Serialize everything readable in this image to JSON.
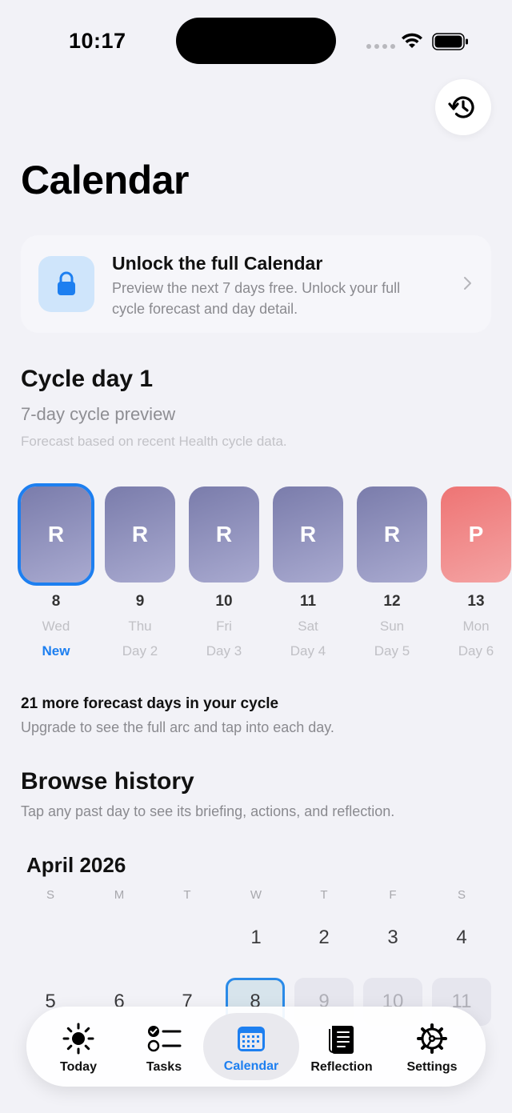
{
  "status": {
    "time": "10:17"
  },
  "header": {
    "title": "Calendar"
  },
  "unlock": {
    "title": "Unlock the full Calendar",
    "description": "Preview the next 7 days free. Unlock your full cycle forecast and day detail."
  },
  "cycle": {
    "title": "Cycle day 1",
    "preview": "7-day cycle preview",
    "note": "Forecast based on recent Health cycle data."
  },
  "days": [
    {
      "letter": "R",
      "num": "8",
      "weekday": "Wed",
      "sub": "New",
      "type": "r",
      "selected": true
    },
    {
      "letter": "R",
      "num": "9",
      "weekday": "Thu",
      "sub": "Day 2",
      "type": "r"
    },
    {
      "letter": "R",
      "num": "10",
      "weekday": "Fri",
      "sub": "Day 3",
      "type": "r"
    },
    {
      "letter": "R",
      "num": "11",
      "weekday": "Sat",
      "sub": "Day 4",
      "type": "r"
    },
    {
      "letter": "R",
      "num": "12",
      "weekday": "Sun",
      "sub": "Day 5",
      "type": "r"
    },
    {
      "letter": "P",
      "num": "13",
      "weekday": "Mon",
      "sub": "Day 6",
      "type": "p"
    }
  ],
  "forecast_more": {
    "title": "21 more forecast days in your cycle",
    "description": "Upgrade to see the full arc and tap into each day."
  },
  "browse": {
    "title": "Browse history",
    "description": "Tap any past day to see its briefing, actions, and reflection."
  },
  "calendar": {
    "month": "April 2026",
    "weekdays": [
      "S",
      "M",
      "T",
      "W",
      "T",
      "F",
      "S"
    ],
    "week1": [
      "1",
      "2",
      "3",
      "4"
    ],
    "week2": [
      "5",
      "6",
      "7",
      "8",
      "9",
      "10",
      "11"
    ]
  },
  "tabs": [
    {
      "label": "Today",
      "icon": "sun-icon"
    },
    {
      "label": "Tasks",
      "icon": "checklist-icon"
    },
    {
      "label": "Calendar",
      "icon": "calendar-icon",
      "active": true
    },
    {
      "label": "Reflection",
      "icon": "journal-icon"
    },
    {
      "label": "Settings",
      "icon": "gear-icon"
    }
  ],
  "colors": {
    "accent": "#1d7ff0",
    "rest_tile": "#7a7cab",
    "period_tile": "#ee7474",
    "background": "#f2f2f7"
  }
}
